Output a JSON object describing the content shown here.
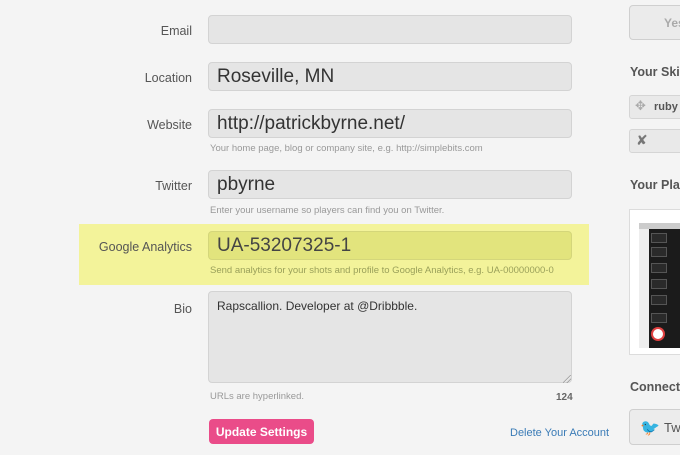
{
  "form": {
    "email": {
      "label": "Email",
      "value": ""
    },
    "location": {
      "label": "Location",
      "value": "Roseville, MN"
    },
    "website": {
      "label": "Website",
      "value": "http://patrickbyrne.net/",
      "hint": "Your home page, blog or company site, e.g. http://simplebits.com"
    },
    "twitter": {
      "label": "Twitter",
      "value": "pbyrne",
      "hint": "Enter your username so players can find you on Twitter."
    },
    "google_analytics": {
      "label": "Google Analytics",
      "value": "UA-53207325-1",
      "hint": "Send analytics for your shots and profile to Google Analytics, e.g. UA-00000000-0"
    },
    "bio": {
      "label": "Bio",
      "value": "Rapscallion. Developer at @Dribbble.",
      "hint": "URLs are hyperlinked.",
      "char_count": "124"
    },
    "update_button": "Update Settings",
    "delete_link": "Delete Your Account",
    "highlight_color": "#f3f39a",
    "accent_color": "#ea4c89"
  },
  "sidebar": {
    "top_button": "Yes",
    "skills_title": "Your Skill",
    "skills": [
      {
        "icon": "move-icon",
        "label": "ruby"
      },
      {
        "icon": "tools-icon",
        "label": ""
      }
    ],
    "player_title": "Your Play",
    "connections_title": "Connecti",
    "twitter_button": "Tw",
    "twitter_color": "#3ba3d9"
  }
}
